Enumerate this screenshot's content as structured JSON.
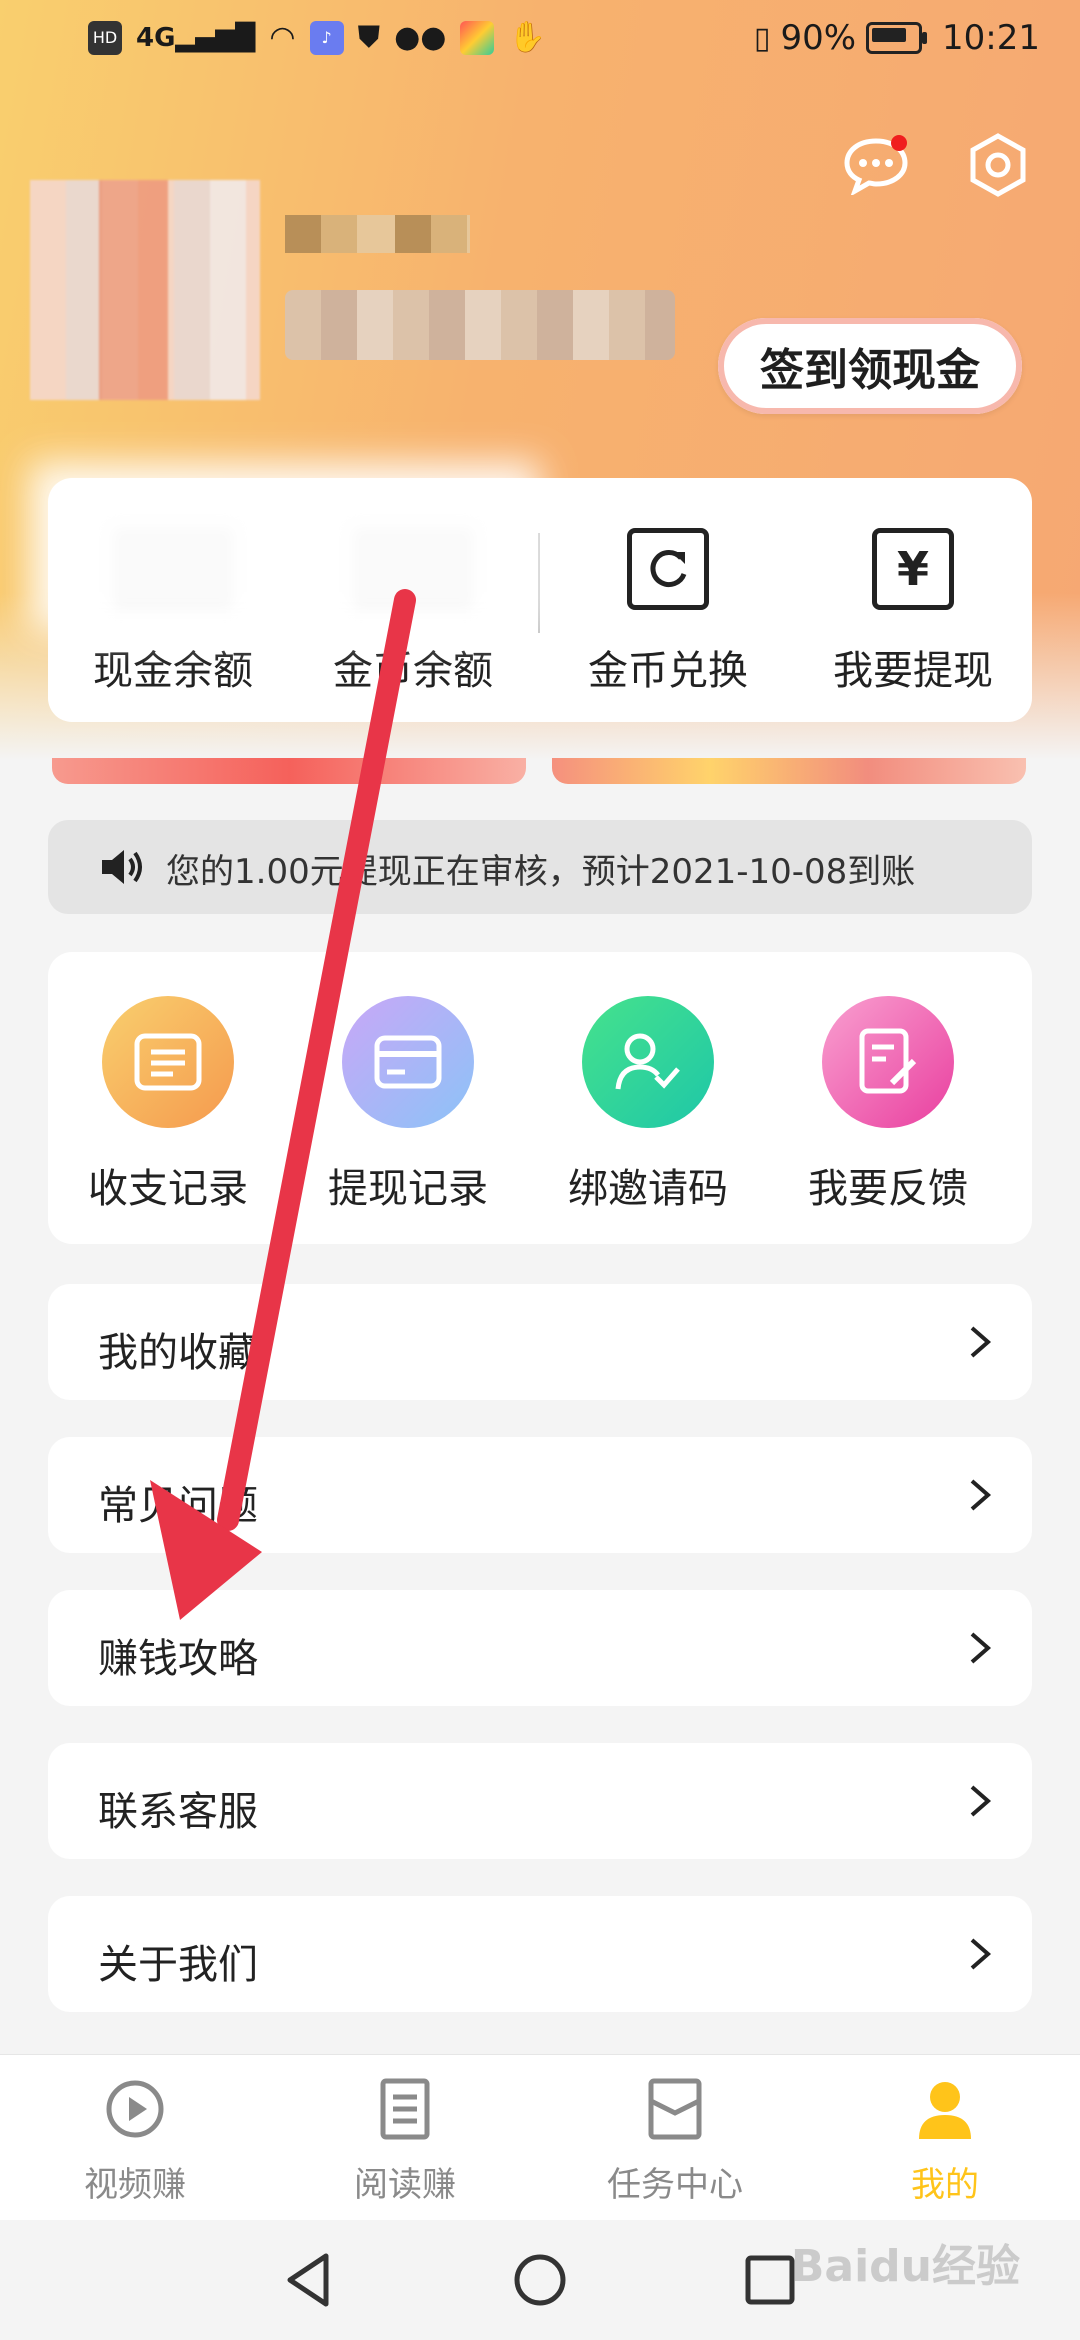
{
  "status_bar": {
    "left_icons": [
      "HD",
      "4G",
      "signal",
      "wifi",
      "music",
      "shield",
      "wechat",
      "app",
      "hand"
    ],
    "battery": "90%",
    "battery_level": 0.9,
    "time": "10:21"
  },
  "header": {
    "message_icon": "chat-bubble-icon",
    "settings_icon": "gear-icon",
    "signin_button": "签到领现金"
  },
  "wallet": {
    "items": [
      {
        "label": "现金余额"
      },
      {
        "label": "金币余额"
      },
      {
        "label": "金币兑换",
        "icon": "refresh-icon"
      },
      {
        "label": "我要提现",
        "icon": "yen-icon",
        "glyph": "¥"
      }
    ]
  },
  "notice": {
    "text": "您的1.00元提现正在审核，预计2021-10-08到账"
  },
  "actions": [
    {
      "label": "收支记录",
      "icon": "ledger-icon",
      "color": "#f6b25c"
    },
    {
      "label": "提现记录",
      "icon": "card-icon",
      "color": "#a9b4f6"
    },
    {
      "label": "绑邀请码",
      "icon": "user-check-icon",
      "color": "#3ed89b"
    },
    {
      "label": "我要反馈",
      "icon": "feedback-icon",
      "color": "#f067b4"
    }
  ],
  "menu": [
    {
      "label": "我的收藏"
    },
    {
      "label": "常见问题"
    },
    {
      "label": "赚钱攻略"
    },
    {
      "label": "联系客服"
    },
    {
      "label": "关于我们"
    }
  ],
  "tabs": [
    {
      "label": "视频赚",
      "icon": "play-icon"
    },
    {
      "label": "阅读赚",
      "icon": "document-icon"
    },
    {
      "label": "任务中心",
      "icon": "task-icon"
    },
    {
      "label": "我的",
      "icon": "person-icon",
      "active": true
    }
  ],
  "system_nav": [
    "back-icon",
    "home-icon",
    "recent-apps-icon"
  ],
  "watermark": "Baidu经验"
}
